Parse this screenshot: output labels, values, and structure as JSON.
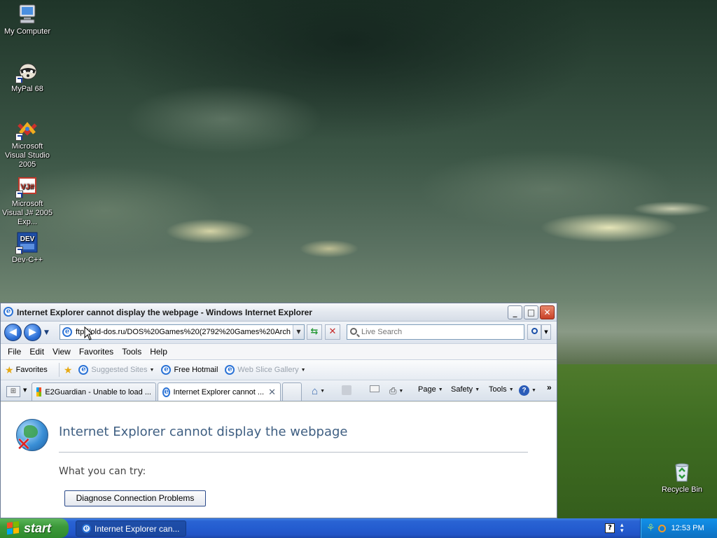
{
  "desktop": {
    "icons": [
      {
        "label": "My Computer"
      },
      {
        "label": "MyPal 68"
      },
      {
        "label": "Microsoft Visual Studio 2005"
      },
      {
        "label": "Microsoft Visual J# 2005 Exp..."
      },
      {
        "label": "Dev-C++"
      },
      {
        "label": "Recycle Bin"
      }
    ]
  },
  "window": {
    "title": "Internet Explorer cannot display the webpage - Windows Internet Explorer",
    "address": "ftp://old-dos.ru/DOS%20Games%20(2792%20Games%20Arch",
    "search_placeholder": "Live Search",
    "menu": [
      "File",
      "Edit",
      "View",
      "Favorites",
      "Tools",
      "Help"
    ],
    "favorites": {
      "label": "Favorites",
      "items": [
        "Suggested Sites",
        "Free Hotmail",
        "Web Slice Gallery"
      ]
    },
    "tabs": [
      {
        "label": "E2Guardian - Unable to load ...",
        "active": false
      },
      {
        "label": "Internet Explorer cannot ...",
        "active": true
      }
    ],
    "commands": {
      "page": "Page",
      "safety": "Safety",
      "tools": "Tools"
    },
    "content": {
      "heading": "Internet Explorer cannot display the webpage",
      "try_text": "What you can try:",
      "diagnose_button": "Diagnose Connection Problems"
    }
  },
  "taskbar": {
    "start_label": "start",
    "task_button": "Internet Explorer can...",
    "clock": "12:53 PM"
  },
  "colors": {
    "taskbar_blue": "#245dd0",
    "start_green": "#3d9a3b",
    "heading_blue": "#3f5f82",
    "close_red": "#c84027"
  }
}
